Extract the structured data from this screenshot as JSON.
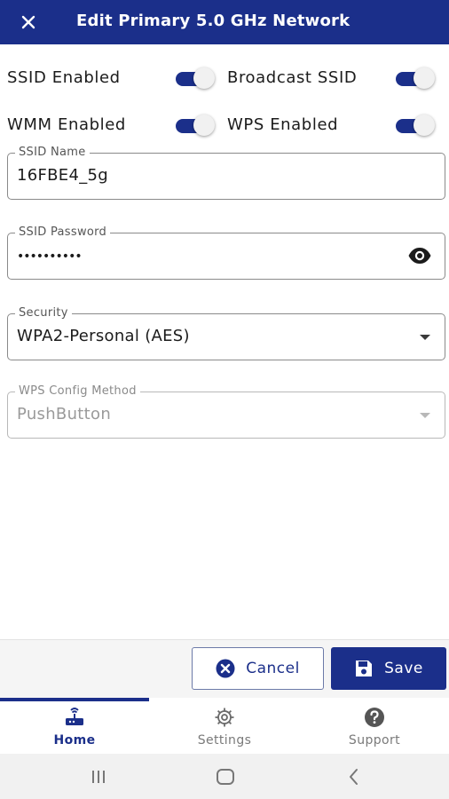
{
  "header": {
    "close_icon": "close-icon",
    "title": "Edit Primary 5.0 GHz Network"
  },
  "toggles": {
    "ssid_enabled": {
      "label": "SSID Enabled",
      "on": true
    },
    "broadcast_ssid": {
      "label": "Broadcast SSID",
      "on": true
    },
    "wmm_enabled": {
      "label": "WMM Enabled",
      "on": true
    },
    "wps_enabled": {
      "label": "WPS Enabled",
      "on": true
    }
  },
  "fields": {
    "ssid_name": {
      "label": "SSID Name",
      "value": "16FBE4_5g"
    },
    "ssid_password": {
      "label": "SSID Password",
      "value": "••••••••••",
      "icon": "eye-icon"
    },
    "security": {
      "label": "Security",
      "value": "WPA2-Personal (AES)"
    },
    "wps_config_method": {
      "label": "WPS Config Method",
      "value": "PushButton",
      "disabled": true
    }
  },
  "actions": {
    "cancel_label": "Cancel",
    "save_label": "Save"
  },
  "bottom_nav": {
    "items": [
      {
        "label": "Home",
        "icon": "router-icon",
        "active": true
      },
      {
        "label": "Settings",
        "icon": "gear-icon",
        "active": false
      },
      {
        "label": "Support",
        "icon": "help-icon",
        "active": false
      }
    ]
  },
  "colors": {
    "primary": "#1b2f8a",
    "border": "#8a8a8a"
  }
}
